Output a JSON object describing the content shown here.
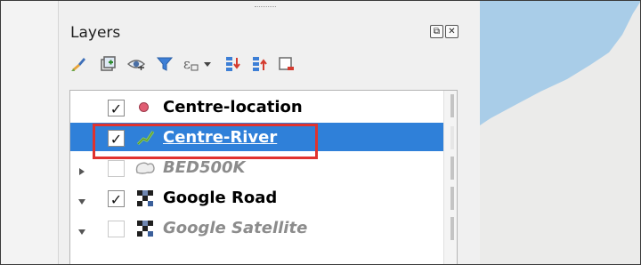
{
  "panel": {
    "title": "Layers",
    "float_button_glyph": "⧉",
    "close_button_glyph": "✕"
  },
  "toolbar": [
    {
      "icon": "style-brush-icon"
    },
    {
      "icon": "add-group-icon"
    },
    {
      "icon": "manage-visibility-eye-icon"
    },
    {
      "icon": "filter-funnel-icon"
    },
    {
      "icon": "filter-expression-icon"
    },
    {
      "icon": "expand-all-icon"
    },
    {
      "icon": "collapse-all-icon"
    },
    {
      "icon": "remove-layer-icon"
    }
  ],
  "layers": [
    {
      "name": "Centre-location",
      "checked": true,
      "check_glyph": "✓",
      "icon": "point-layer-icon",
      "expander": "none",
      "dim": false,
      "selected": false
    },
    {
      "name": "Centre-River",
      "checked": true,
      "check_glyph": "✓",
      "icon": "line-layer-icon",
      "expander": "none",
      "dim": false,
      "selected": true
    },
    {
      "name": "BED500K",
      "checked": false,
      "check_glyph": "",
      "icon": "polygon-layer-icon",
      "expander": "collapsed",
      "dim": true,
      "selected": false
    },
    {
      "name": "Google Road",
      "checked": true,
      "check_glyph": "✓",
      "icon": "raster-layer-icon",
      "expander": "expanded",
      "dim": false,
      "selected": false
    },
    {
      "name": "Google Satellite",
      "checked": false,
      "check_glyph": "",
      "icon": "raster-layer-icon",
      "expander": "expanded",
      "dim": true,
      "selected": false
    }
  ],
  "colors": {
    "selection": "#2f80d9",
    "highlight_box": "#e0322e",
    "point_symbol": "#e05d73",
    "map_water": "#a9cde8",
    "map_land": "#ebebea"
  }
}
